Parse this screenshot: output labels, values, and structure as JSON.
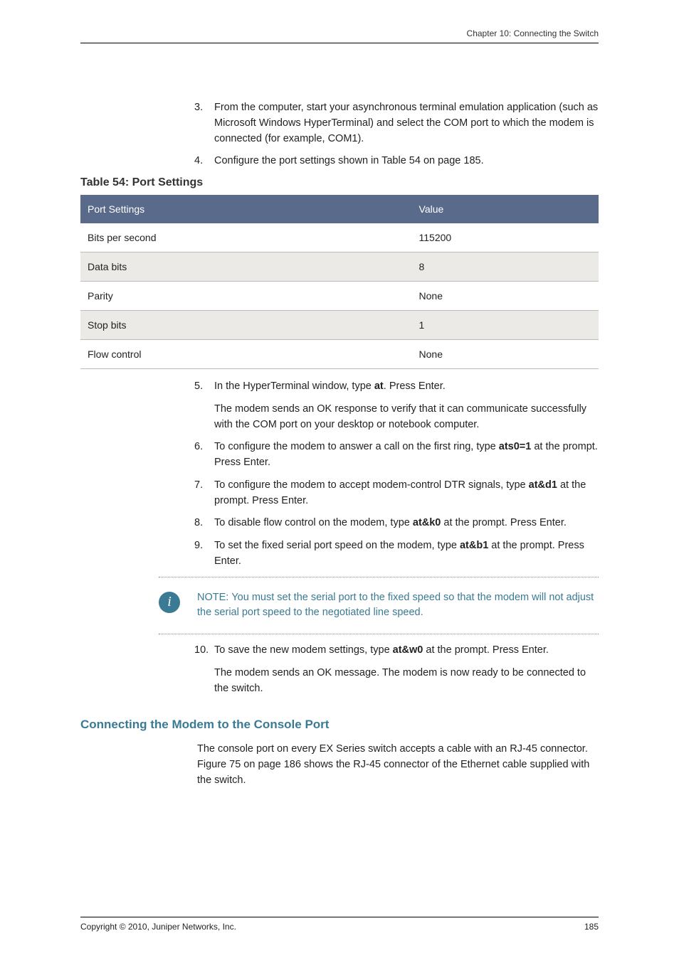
{
  "header": {
    "chapter": "Chapter 10: Connecting the Switch"
  },
  "list1": {
    "item3": {
      "num": "3.",
      "text": "From the computer, start your asynchronous terminal emulation application (such as Microsoft Windows HyperTerminal) and select the COM port to which the modem is connected (for example, COM1)."
    },
    "item4": {
      "num": "4.",
      "text": "Configure the port settings shown in Table 54 on page 185."
    }
  },
  "table": {
    "caption": "Table 54: Port Settings",
    "col1": "Port Settings",
    "col2": "Value",
    "rows": [
      {
        "k": "Bits per second",
        "v": "115200"
      },
      {
        "k": "Data bits",
        "v": "8"
      },
      {
        "k": "Parity",
        "v": "None"
      },
      {
        "k": "Stop bits",
        "v": "1"
      },
      {
        "k": "Flow control",
        "v": "None"
      }
    ]
  },
  "list2": {
    "item5": {
      "num": "5.",
      "pre": "In the HyperTerminal window, type ",
      "cmd": "at",
      "post": ". Press Enter.",
      "para": "The modem sends an OK response to verify that it can communicate successfully with the COM port on your desktop or notebook computer."
    },
    "item6": {
      "num": "6.",
      "pre": "To configure the modem to answer a call on the first ring, type ",
      "cmd": "ats0=1",
      "post": " at the prompt. Press Enter."
    },
    "item7": {
      "num": "7.",
      "pre": "To configure the modem to accept modem-control DTR signals, type ",
      "cmd": "at&d1",
      "post": " at the prompt. Press Enter."
    },
    "item8": {
      "num": "8.",
      "pre": "To disable flow control on the modem, type ",
      "cmd": "at&k0",
      "post": " at the prompt. Press Enter."
    },
    "item9": {
      "num": "9.",
      "pre": "To set the fixed serial port speed on the modem, type ",
      "cmd": "at&b1",
      "post": " at the prompt. Press Enter."
    },
    "item10": {
      "num": "10.",
      "pre": "To save the new modem settings, type ",
      "cmd": "at&w0",
      "post": " at the prompt. Press Enter.",
      "para": "The modem sends an OK message. The modem is now ready to be connected to the switch."
    }
  },
  "note": {
    "label": "NOTE:",
    "text": "You must set the serial port to the fixed speed so that the modem will not adjust the serial port speed to the negotiated line speed."
  },
  "section": {
    "heading": "Connecting the Modem to the Console Port",
    "para": "The console port on every EX Series switch accepts a cable with an RJ-45 connector. Figure 75 on page 186 shows the RJ-45 connector of the Ethernet cable supplied with the switch."
  },
  "footer": {
    "copyright": "Copyright © 2010, Juniper Networks, Inc.",
    "page": "185"
  }
}
